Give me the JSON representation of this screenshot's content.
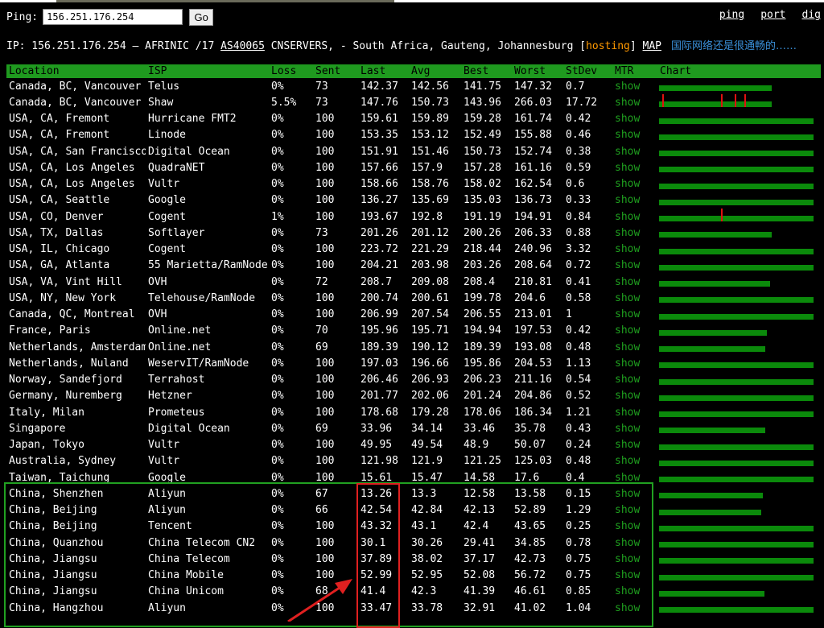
{
  "ping": {
    "label": "Ping:",
    "value": "156.251.176.254",
    "go_label": "Go"
  },
  "links": [
    "ping",
    "port",
    "dig"
  ],
  "info": {
    "prefix": "IP: 156.251.176.254 – AFRINIC /17 ",
    "asn": "AS40065",
    "middle": " CNSERVERS, - South Africa, Gauteng, Johannesburg [",
    "hosting": "hosting",
    "close": "] ",
    "map": "MAP",
    "note": "国际网络还是很通畅的……"
  },
  "headers": [
    "Location",
    "ISP",
    "Loss",
    "Sent",
    "Last",
    "Avg",
    "Best",
    "Worst",
    "StDev",
    "MTR",
    "Chart"
  ],
  "rows": [
    {
      "location": "Canada, BC, Vancouver",
      "isp": "Telus",
      "loss": "0%",
      "sent": "73",
      "last": "142.37",
      "avg": "142.56",
      "best": "141.75",
      "worst": "147.32",
      "stdev": "0.7",
      "mtr": "show",
      "chart_fill": 0.73,
      "spikes": []
    },
    {
      "location": "Canada, BC, Vancouver",
      "isp": "Shaw",
      "loss": "5.5%",
      "sent": "73",
      "last": "147.76",
      "avg": "150.73",
      "best": "143.96",
      "worst": "266.03",
      "stdev": "17.72",
      "mtr": "show",
      "chart_fill": 0.73,
      "spikes": [
        0.02,
        0.4,
        0.49,
        0.55
      ]
    },
    {
      "location": "USA, CA, Fremont",
      "isp": "Hurricane FMT2",
      "loss": "0%",
      "sent": "100",
      "last": "159.61",
      "avg": "159.89",
      "best": "159.28",
      "worst": "161.74",
      "stdev": "0.42",
      "mtr": "show",
      "chart_fill": 1.0,
      "spikes": []
    },
    {
      "location": "USA, CA, Fremont",
      "isp": "Linode",
      "loss": "0%",
      "sent": "100",
      "last": "153.35",
      "avg": "153.12",
      "best": "152.49",
      "worst": "155.88",
      "stdev": "0.46",
      "mtr": "show",
      "chart_fill": 1.0,
      "spikes": []
    },
    {
      "location": "USA, CA, San Francisco",
      "isp": "Digital Ocean",
      "loss": "0%",
      "sent": "100",
      "last": "151.91",
      "avg": "151.46",
      "best": "150.73",
      "worst": "152.74",
      "stdev": "0.38",
      "mtr": "show",
      "chart_fill": 1.0,
      "spikes": []
    },
    {
      "location": "USA, CA, Los Angeles",
      "isp": "QuadraNET",
      "loss": "0%",
      "sent": "100",
      "last": "157.66",
      "avg": "157.9",
      "best": "157.28",
      "worst": "161.16",
      "stdev": "0.59",
      "mtr": "show",
      "chart_fill": 1.0,
      "spikes": []
    },
    {
      "location": "USA, CA, Los Angeles",
      "isp": "Vultr",
      "loss": "0%",
      "sent": "100",
      "last": "158.66",
      "avg": "158.76",
      "best": "158.02",
      "worst": "162.54",
      "stdev": "0.6",
      "mtr": "show",
      "chart_fill": 1.0,
      "spikes": []
    },
    {
      "location": "USA, CA, Seattle",
      "isp": "Google",
      "loss": "0%",
      "sent": "100",
      "last": "136.27",
      "avg": "135.69",
      "best": "135.03",
      "worst": "136.73",
      "stdev": "0.33",
      "mtr": "show",
      "chart_fill": 1.0,
      "spikes": []
    },
    {
      "location": "USA, CO, Denver",
      "isp": "Cogent",
      "loss": "1%",
      "sent": "100",
      "last": "193.67",
      "avg": "192.8",
      "best": "191.19",
      "worst": "194.91",
      "stdev": "0.84",
      "mtr": "show",
      "chart_fill": 1.0,
      "spikes": [
        0.4
      ]
    },
    {
      "location": "USA, TX, Dallas",
      "isp": "Softlayer",
      "loss": "0%",
      "sent": "73",
      "last": "201.26",
      "avg": "201.12",
      "best": "200.26",
      "worst": "206.33",
      "stdev": "0.88",
      "mtr": "show",
      "chart_fill": 0.73,
      "spikes": []
    },
    {
      "location": "USA, IL, Chicago",
      "isp": "Cogent",
      "loss": "0%",
      "sent": "100",
      "last": "223.72",
      "avg": "221.29",
      "best": "218.44",
      "worst": "240.96",
      "stdev": "3.32",
      "mtr": "show",
      "chart_fill": 1.0,
      "spikes": []
    },
    {
      "location": "USA, GA, Atlanta",
      "isp": "55 Marietta/RamNode",
      "loss": "0%",
      "sent": "100",
      "last": "204.21",
      "avg": "203.98",
      "best": "203.26",
      "worst": "208.64",
      "stdev": "0.72",
      "mtr": "show",
      "chart_fill": 1.0,
      "spikes": []
    },
    {
      "location": "USA, VA, Vint Hill",
      "isp": "OVH",
      "loss": "0%",
      "sent": "72",
      "last": "208.7",
      "avg": "209.08",
      "best": "208.4",
      "worst": "210.81",
      "stdev": "0.41",
      "mtr": "show",
      "chart_fill": 0.72,
      "spikes": []
    },
    {
      "location": "USA, NY, New York",
      "isp": "Telehouse/RamNode",
      "loss": "0%",
      "sent": "100",
      "last": "200.74",
      "avg": "200.61",
      "best": "199.78",
      "worst": "204.6",
      "stdev": "0.58",
      "mtr": "show",
      "chart_fill": 1.0,
      "spikes": []
    },
    {
      "location": "Canada, QC, Montreal",
      "isp": "OVH",
      "loss": "0%",
      "sent": "100",
      "last": "206.99",
      "avg": "207.54",
      "best": "206.55",
      "worst": "213.01",
      "stdev": "1",
      "mtr": "show",
      "chart_fill": 1.0,
      "spikes": []
    },
    {
      "location": "France, Paris",
      "isp": "Online.net",
      "loss": "0%",
      "sent": "70",
      "last": "195.96",
      "avg": "195.71",
      "best": "194.94",
      "worst": "197.53",
      "stdev": "0.42",
      "mtr": "show",
      "chart_fill": 0.7,
      "spikes": []
    },
    {
      "location": "Netherlands, Amsterdam",
      "isp": "Online.net",
      "loss": "0%",
      "sent": "69",
      "last": "189.39",
      "avg": "190.12",
      "best": "189.39",
      "worst": "193.08",
      "stdev": "0.48",
      "mtr": "show",
      "chart_fill": 0.69,
      "spikes": []
    },
    {
      "location": "Netherlands, Nuland",
      "isp": "WeservIT/RamNode",
      "loss": "0%",
      "sent": "100",
      "last": "197.03",
      "avg": "196.66",
      "best": "195.86",
      "worst": "204.53",
      "stdev": "1.13",
      "mtr": "show",
      "chart_fill": 1.0,
      "spikes": []
    },
    {
      "location": "Norway, Sandefjord",
      "isp": "Terrahost",
      "loss": "0%",
      "sent": "100",
      "last": "206.46",
      "avg": "206.93",
      "best": "206.23",
      "worst": "211.16",
      "stdev": "0.54",
      "mtr": "show",
      "chart_fill": 1.0,
      "spikes": []
    },
    {
      "location": "Germany, Nuremberg",
      "isp": "Hetzner",
      "loss": "0%",
      "sent": "100",
      "last": "201.77",
      "avg": "202.06",
      "best": "201.24",
      "worst": "204.86",
      "stdev": "0.52",
      "mtr": "show",
      "chart_fill": 1.0,
      "spikes": []
    },
    {
      "location": "Italy, Milan",
      "isp": "Prometeus",
      "loss": "0%",
      "sent": "100",
      "last": "178.68",
      "avg": "179.28",
      "best": "178.06",
      "worst": "186.34",
      "stdev": "1.21",
      "mtr": "show",
      "chart_fill": 1.0,
      "spikes": []
    },
    {
      "location": "Singapore",
      "isp": "Digital Ocean",
      "loss": "0%",
      "sent": "69",
      "last": "33.96",
      "avg": "34.14",
      "best": "33.46",
      "worst": "35.78",
      "stdev": "0.43",
      "mtr": "show",
      "chart_fill": 0.69,
      "spikes": []
    },
    {
      "location": "Japan, Tokyo",
      "isp": "Vultr",
      "loss": "0%",
      "sent": "100",
      "last": "49.95",
      "avg": "49.54",
      "best": "48.9",
      "worst": "50.07",
      "stdev": "0.24",
      "mtr": "show",
      "chart_fill": 1.0,
      "spikes": []
    },
    {
      "location": "Australia, Sydney",
      "isp": "Vultr",
      "loss": "0%",
      "sent": "100",
      "last": "121.98",
      "avg": "121.9",
      "best": "121.25",
      "worst": "125.03",
      "stdev": "0.48",
      "mtr": "show",
      "chart_fill": 1.0,
      "spikes": []
    },
    {
      "location": "Taiwan, Taichung",
      "isp": "Google",
      "loss": "0%",
      "sent": "100",
      "last": "15.61",
      "avg": "15.47",
      "best": "14.58",
      "worst": "17.6",
      "stdev": "0.4",
      "mtr": "show",
      "chart_fill": 1.0,
      "spikes": []
    },
    {
      "location": "China, Shenzhen",
      "isp": "Aliyun",
      "loss": "0%",
      "sent": "67",
      "last": "13.26",
      "avg": "13.3",
      "best": "12.58",
      "worst": "13.58",
      "stdev": "0.15",
      "mtr": "show",
      "chart_fill": 0.67,
      "spikes": []
    },
    {
      "location": "China, Beijing",
      "isp": "Aliyun",
      "loss": "0%",
      "sent": "66",
      "last": "42.54",
      "avg": "42.84",
      "best": "42.13",
      "worst": "52.89",
      "stdev": "1.29",
      "mtr": "show",
      "chart_fill": 0.66,
      "spikes": []
    },
    {
      "location": "China, Beijing",
      "isp": "Tencent",
      "loss": "0%",
      "sent": "100",
      "last": "43.32",
      "avg": "43.1",
      "best": "42.4",
      "worst": "43.65",
      "stdev": "0.25",
      "mtr": "show",
      "chart_fill": 1.0,
      "spikes": []
    },
    {
      "location": "China, Quanzhou",
      "isp": "China Telecom CN2",
      "loss": "0%",
      "sent": "100",
      "last": "30.1",
      "avg": "30.26",
      "best": "29.41",
      "worst": "34.85",
      "stdev": "0.78",
      "mtr": "show",
      "chart_fill": 1.0,
      "spikes": []
    },
    {
      "location": "China, Jiangsu",
      "isp": "China Telecom",
      "loss": "0%",
      "sent": "100",
      "last": "37.89",
      "avg": "38.02",
      "best": "37.17",
      "worst": "42.73",
      "stdev": "0.75",
      "mtr": "show",
      "chart_fill": 1.0,
      "spikes": []
    },
    {
      "location": "China, Jiangsu",
      "isp": "China Mobile",
      "loss": "0%",
      "sent": "100",
      "last": "52.99",
      "avg": "52.95",
      "best": "52.08",
      "worst": "56.72",
      "stdev": "0.75",
      "mtr": "show",
      "chart_fill": 1.0,
      "spikes": []
    },
    {
      "location": "China, Jiangsu",
      "isp": "China Unicom",
      "loss": "0%",
      "sent": "68",
      "last": "41.4",
      "avg": "42.3",
      "best": "41.39",
      "worst": "46.61",
      "stdev": "0.85",
      "mtr": "show",
      "chart_fill": 0.68,
      "spikes": []
    },
    {
      "location": "China, Hangzhou",
      "isp": "Aliyun",
      "loss": "0%",
      "sent": "100",
      "last": "33.47",
      "avg": "33.78",
      "best": "32.91",
      "worst": "41.02",
      "stdev": "1.04",
      "mtr": "show",
      "chart_fill": 1.0,
      "spikes": []
    }
  ],
  "colors": {
    "header_bg": "#1f9a1f",
    "mtr_link": "#1fa01f",
    "hosting": "#ff9900",
    "note": "#3a8fd8",
    "chart_bar": "#0b8a0b",
    "spike": "#e01010",
    "highlight_green": "#21a021",
    "highlight_red": "#e02020"
  }
}
